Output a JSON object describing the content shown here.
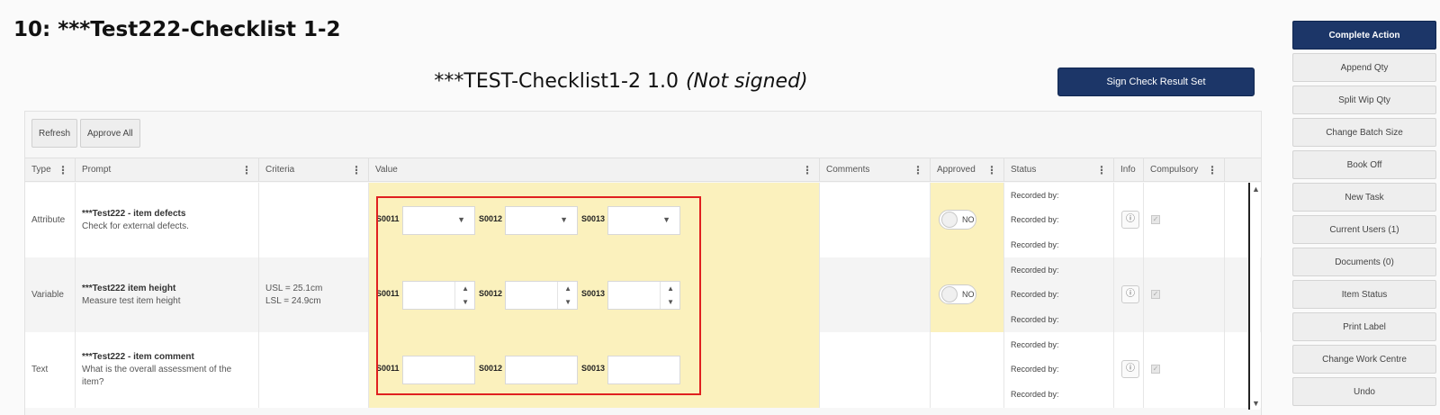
{
  "page": {
    "title": "10: ***Test222-Checklist 1-2",
    "checklist_name": "***TEST-Checklist1-2 1.0",
    "checklist_status": "(Not signed)",
    "sign_button": "Sign Check Result Set"
  },
  "toolbar": {
    "refresh": "Refresh",
    "approve_all": "Approve All"
  },
  "columns": {
    "type": "Type",
    "prompt": "Prompt",
    "criteria": "Criteria",
    "value": "Value",
    "comments": "Comments",
    "approved": "Approved",
    "status": "Status",
    "info": "Info",
    "compulsory": "Compulsory"
  },
  "rows": [
    {
      "type": "Attribute",
      "prompt_title": "***Test222 - item defects",
      "prompt_desc": "Check for external defects.",
      "criteria_1": "",
      "criteria_2": "",
      "samples": [
        "S0011",
        "S0012",
        "S0013"
      ],
      "input_kind": "dropdown",
      "approved": "NO",
      "status": [
        "Recorded by:",
        "Recorded by:",
        "Recorded by:"
      ]
    },
    {
      "type": "Variable",
      "prompt_title": "***Test222 item height",
      "prompt_desc": "Measure test item height",
      "criteria_1": "USL = 25.1cm",
      "criteria_2": "LSL = 24.9cm",
      "samples": [
        "S0011",
        "S0012",
        "S0013"
      ],
      "input_kind": "number",
      "approved": "NO",
      "status": [
        "Recorded by:",
        "Recorded by:",
        "Recorded by:"
      ]
    },
    {
      "type": "Text",
      "prompt_title": "***Test222 - item comment",
      "prompt_desc": "What is the overall assessment of the item?",
      "criteria_1": "",
      "criteria_2": "",
      "samples": [
        "S0011",
        "S0012",
        "S0013"
      ],
      "input_kind": "text",
      "approved": "",
      "status": [
        "Recorded by:",
        "Recorded by:",
        "Recorded by:"
      ]
    }
  ],
  "sidebar": {
    "buttons": [
      "Complete Action",
      "Append Qty",
      "Split Wip Qty",
      "Change Batch Size",
      "Book Off",
      "New Task",
      "Current Users (1)",
      "Documents (0)",
      "Item Status",
      "Print Label",
      "Change Work Centre",
      "Undo"
    ]
  },
  "colors": {
    "primary": "#1c3668",
    "value_highlight": "#fbf1bd",
    "annotation": "#e02020"
  }
}
